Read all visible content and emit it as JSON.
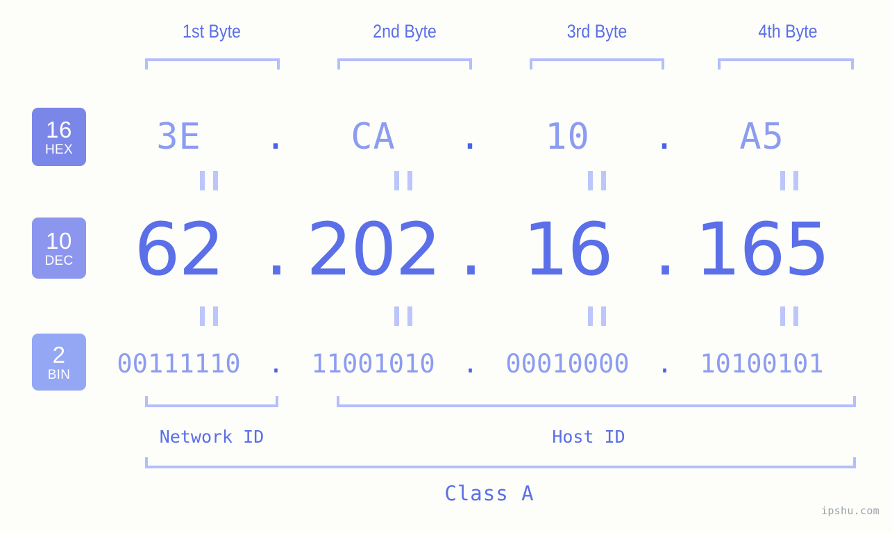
{
  "meta": {
    "watermark": "ipshu.com",
    "background_color": "#fdfdfa",
    "accent_color": "#5a6fe8",
    "accent_light_color": "#8c9cf0",
    "bracket_color": "#b4befc"
  },
  "byte_headers": [
    {
      "label": "1st Byte"
    },
    {
      "label": "2nd Byte"
    },
    {
      "label": "3rd Byte"
    },
    {
      "label": "4th Byte"
    }
  ],
  "bases": [
    {
      "number": "16",
      "name": "HEX",
      "color": "#7b86e9"
    },
    {
      "number": "10",
      "name": "DEC",
      "color": "#8c96ee"
    },
    {
      "number": "2",
      "name": "BIN",
      "color": "#94a7f5"
    }
  ],
  "rows": {
    "hex": {
      "base_number": "16",
      "base_name": "HEX",
      "values": [
        "3E",
        "CA",
        "10",
        "A5"
      ],
      "separator": "."
    },
    "dec": {
      "base_number": "10",
      "base_name": "DEC",
      "values": [
        "62",
        "202",
        "16",
        "165"
      ],
      "separator": "."
    },
    "bin": {
      "base_number": "2",
      "base_name": "BIN",
      "values": [
        "00111110",
        "11001010",
        "00010000",
        "10100101"
      ],
      "separator": "."
    }
  },
  "equality_marks": {
    "glyph": "=",
    "count_per_row": 4,
    "rows": 2
  },
  "segments": {
    "network_id": {
      "label": "Network ID",
      "bytes": 1
    },
    "host_id": {
      "label": "Host ID",
      "bytes": 3
    }
  },
  "class": {
    "label": "Class A"
  }
}
